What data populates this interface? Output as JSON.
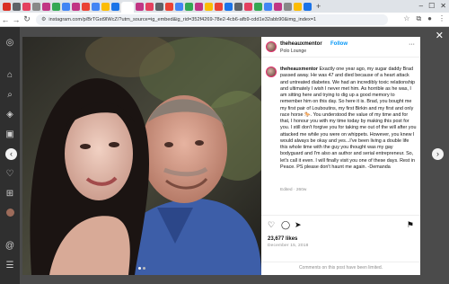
{
  "browser": {
    "url": "instagram.com/p/BrTGst9lWcZ/?utm_source=ig_embed&ig_rid=352f4269-78e2-4cb6-afb9-cdd1e32abb90&img_index=1",
    "tab_colors": [
      "#d93025",
      "#5f6368",
      "#e4405f",
      "#888",
      "#c13584",
      "#34a853",
      "#4285f4",
      "#c13584",
      "#ea4335",
      "#4285f4",
      "#fbbc04",
      "#1a73e8",
      "#c13584",
      "#e4405f",
      "#5f6368",
      "#ea4335",
      "#4285f4",
      "#34a853",
      "#c13584",
      "#fbbc04",
      "#ea4335",
      "#1a73e8",
      "#5f6368",
      "#e4405f",
      "#34a853",
      "#4285f4",
      "#c13584",
      "#888",
      "#fbbc04",
      "#1a73e8"
    ]
  },
  "post": {
    "username": "theheauxmentor",
    "follow_label": "Follow",
    "location": "Polo Lounge",
    "caption_username": "theheauxmentor",
    "caption": "Exactly one year ago, my sugar daddy Brad passed away. He was 47 and died because of a heart attack and untreated diabetes. We had an incredibly toxic relationship and ultimately I wish I never met him. As horrible as he was, I am sitting here and trying to dig up a good memory to remember him on this day. So here it is. Brad, you bought me my first pair of Louboutins, my first Birkin and my first and only race horse 🐎. You understood the value of my time and for that, I honour you with my time today by making this post for you. I still don't forgive you for taking me out of the will after you attacked me while you were on whippets. However, you knew I would always be okay and yes...I've been living a double life this whole time with the guy you thought was my gay bodyguard and I'm also an author and serial entrepreneur. So, let's call it even. I will finally visit you one of these days. Rest in Peace. PS please don't haunt me again. -Demanda",
    "edited": "Edited · 260w",
    "likes": "23,677 likes",
    "date": "December 15, 2018",
    "comments_notice": "Comments on this post have been limited."
  }
}
